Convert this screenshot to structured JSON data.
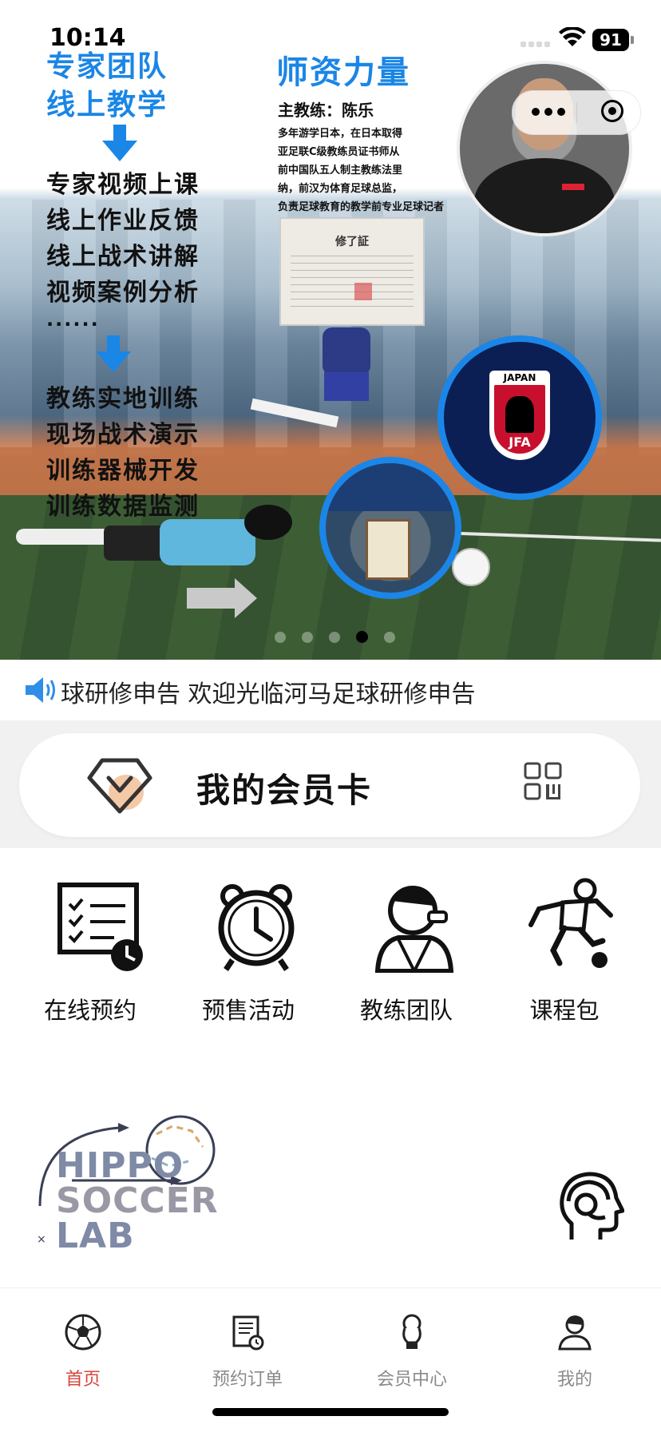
{
  "status": {
    "time": "10:14",
    "battery": "91"
  },
  "banner": {
    "left_headline": [
      "专家团队",
      "线上教学"
    ],
    "online_items": [
      "专家视频上课",
      "线上作业反馈",
      "线上战术讲解",
      "视频案例分析"
    ],
    "ellipsis": "......",
    "offline_items": [
      "教练实地训练",
      "现场战术演示",
      "训练器械开发",
      "训练数据监测"
    ],
    "teacher_title": "师资力量",
    "coach_name": "主教练：陈乐",
    "coach_bio": [
      "多年游学日本，在日本取得",
      "亚足联C级教练员证书师从",
      "前中国队五人制主教练法里",
      "纳，前汉为体育足球总监，",
      "负责足球教育的教学前专业足球记者"
    ],
    "certificate_title": "修了証",
    "jfa_top": "JAPAN",
    "jfa_bottom": "JFA",
    "slide_count": 5,
    "active_slide": 4
  },
  "notice": {
    "icon": "speaker-icon",
    "text": "球研修申告  欢迎光临河马足球研修申告"
  },
  "member_card": {
    "title": "我的会员卡",
    "vip_icon": "vip-diamond-icon",
    "qr_icon": "qr-code-icon",
    "accent": "#f4c9a6"
  },
  "grid": [
    {
      "label": "在线预约",
      "icon": "checklist-clock-icon"
    },
    {
      "label": "预售活动",
      "icon": "alarm-clock-icon"
    },
    {
      "label": "教练团队",
      "icon": "referee-whistle-icon"
    },
    {
      "label": "课程包",
      "icon": "soccer-player-icon"
    }
  ],
  "logo": {
    "lines": [
      "HIPPO",
      "SOCCER",
      "LAB"
    ]
  },
  "tabbar": {
    "items": [
      {
        "label": "首页",
        "icon": "soccer-ball-icon",
        "active": true
      },
      {
        "label": "预约订单",
        "icon": "order-document-icon",
        "active": false
      },
      {
        "label": "会员中心",
        "icon": "trophy-icon",
        "active": false
      },
      {
        "label": "我的",
        "icon": "user-profile-icon",
        "active": false
      }
    ],
    "active_color": "#d6463a",
    "inactive_color": "#8a8a8a"
  }
}
